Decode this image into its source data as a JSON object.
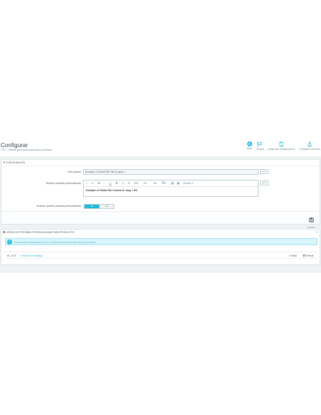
{
  "header": {
    "title": "Configurar",
    "subtitle": "TPC - Viñetas personalizadas para productos",
    "toolbar": [
      {
        "label": "Atrás",
        "icon": "back-icon"
      },
      {
        "label": "Traducir",
        "icon": "flag-icon"
      },
      {
        "label": "Comprobar actualizaciones",
        "icon": "refresh-icon"
      },
      {
        "label": "Configurar los hooks",
        "icon": "anchor-icon"
      }
    ]
  },
  "config_panel": {
    "heading": "Configuración",
    "global_tab_label": "Texto global",
    "global_tab_value": "Example of Global Tab Title id_lang: 1",
    "custom_size_label": "Tamaño pestaña personalizada",
    "editor_content": "Example of Global Tab Content id_lang: 1 ES",
    "editor_format_label": "Párrafo",
    "lang_code": "es",
    "show_size_label": "Mostrar tamaño pestaña personalizada",
    "toggle_yes": "SÍ",
    "toggle_no": "NO",
    "save_label": "Guardar"
  },
  "tabs_panel": {
    "heading": "Listado de pestañas personalizadas para productos",
    "info_text": "Debe asociar cada pestaña a uno o varios productos dentro del editor del producto.",
    "rows": [
      {
        "id": "#1 - ID 6",
        "link_label": "Mostrar en catálogo",
        "edit_label": "Editar",
        "delete_label": "Eliminar"
      }
    ]
  },
  "colors": {
    "accent": "#25b9d7",
    "title": "#363a41",
    "info_bg": "#d9f4fa"
  }
}
